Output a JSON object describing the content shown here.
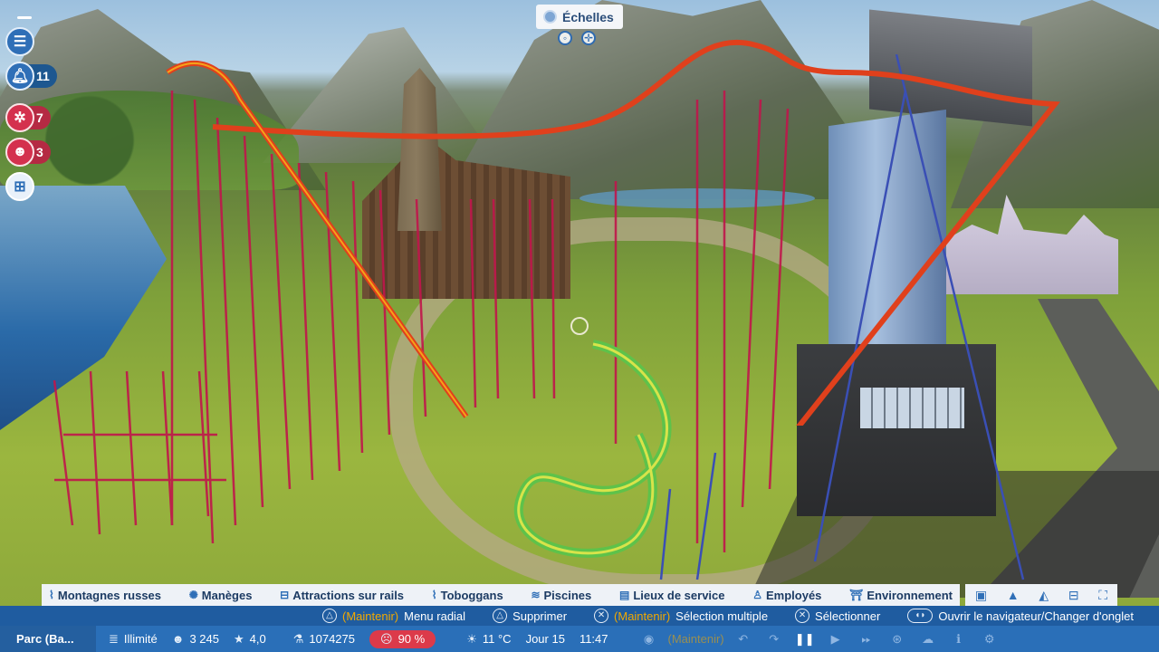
{
  "scale_chip": {
    "label": "Échelles"
  },
  "left_hud": {
    "notifications_count": "11",
    "alerts_count": "7",
    "guests_count": "3"
  },
  "categories": [
    {
      "label": "Montagnes russes",
      "icon": "coaster-icon"
    },
    {
      "label": "Manèges",
      "icon": "ride-icon"
    },
    {
      "label": "Attractions sur rails",
      "icon": "rail-ride-icon"
    },
    {
      "label": "Toboggans",
      "icon": "slide-icon"
    },
    {
      "label": "Piscines",
      "icon": "pool-icon"
    },
    {
      "label": "Lieux de service",
      "icon": "facility-icon"
    },
    {
      "label": "Employés",
      "icon": "staff-icon"
    },
    {
      "label": "Environnement",
      "icon": "scenery-icon"
    }
  ],
  "tools": [
    "blueprint-icon",
    "path-icon",
    "terrain-icon",
    "management-icon",
    "expand-icon"
  ],
  "hints": {
    "radial_hold": "(Maintenir)",
    "radial_label": "Menu radial",
    "delete_label": "Supprimer",
    "multi_hold": "(Maintenir)",
    "multi_label": "Sélection multiple",
    "select_label": "Sélectionner",
    "browser_label": "Ouvrir le navigateur/Changer d'onglet"
  },
  "status": {
    "park_name": "Parc (Ba...",
    "money": "Illimité",
    "guests": "3 245",
    "rating": "4,0",
    "value": "1074275",
    "happiness": "90 %",
    "temperature": "11 °C",
    "day": "Jour 15",
    "time": "11:47",
    "maintain": "(Maintenir)"
  },
  "colors": {
    "hud_blue": "#2a6fb8",
    "hint_blue": "#1f5ca0",
    "alert_red": "#d4314e",
    "hold_orange": "#f2a900"
  }
}
